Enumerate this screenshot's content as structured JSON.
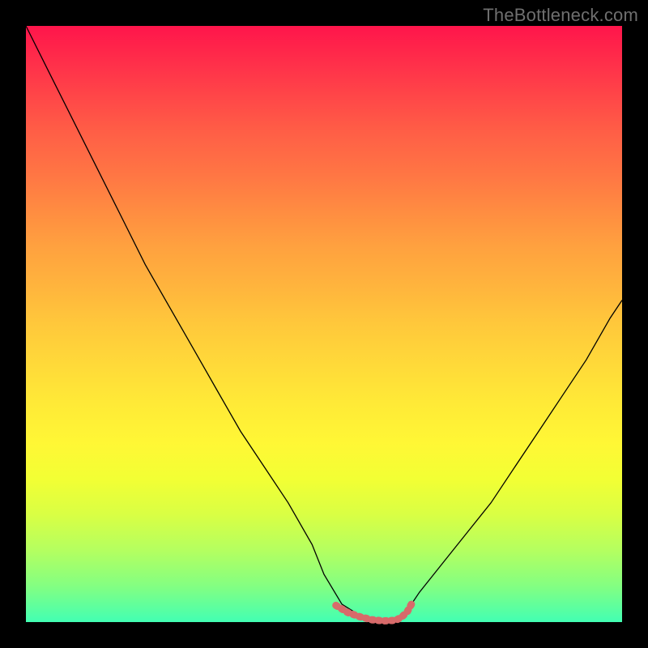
{
  "watermark": {
    "text": "TheBottleneck.com"
  },
  "chart_data": {
    "type": "line",
    "title": "",
    "xlabel": "",
    "ylabel": "",
    "xlim": [
      0,
      100
    ],
    "ylim": [
      0,
      100
    ],
    "grid": false,
    "legend": false,
    "background_gradient": {
      "orientation": "vertical",
      "stops": [
        {
          "pct": 0,
          "color": "#ff154b"
        },
        {
          "pct": 25,
          "color": "#ff7644"
        },
        {
          "pct": 50,
          "color": "#ffc83b"
        },
        {
          "pct": 76,
          "color": "#f2ff34"
        },
        {
          "pct": 100,
          "color": "#42ffb3"
        }
      ]
    },
    "series": [
      {
        "name": "curve",
        "color": "#000000",
        "stroke_width": 1.3,
        "x": [
          0.0,
          4.0,
          8.0,
          12.0,
          16.0,
          20.0,
          24.0,
          28.0,
          32.0,
          36.0,
          40.0,
          44.0,
          48.0,
          50.0,
          53.0,
          57.0,
          61.0,
          63.0,
          64.0,
          66.0,
          70.0,
          74.0,
          78.0,
          82.0,
          86.0,
          90.0,
          94.0,
          98.0,
          100.0
        ],
        "y": [
          100.0,
          92.0,
          84.0,
          76.0,
          68.0,
          60.0,
          53.0,
          46.0,
          39.0,
          32.0,
          26.0,
          20.0,
          13.0,
          8.0,
          3.0,
          0.5,
          0.0,
          0.5,
          2.0,
          5.0,
          10.0,
          15.0,
          20.0,
          26.0,
          32.0,
          38.0,
          44.0,
          51.0,
          54.0
        ]
      },
      {
        "name": "flat-bottom-marker",
        "color": "#d76a6a",
        "stroke_width": 9,
        "dash": [
          2,
          6
        ],
        "linecap": "round",
        "x": [
          52.0,
          54.0,
          56.0,
          58.0,
          60.0,
          62.0,
          63.0,
          64.0,
          65.0
        ],
        "y": [
          2.8,
          1.6,
          0.9,
          0.4,
          0.2,
          0.3,
          0.8,
          1.8,
          3.6
        ]
      }
    ]
  }
}
